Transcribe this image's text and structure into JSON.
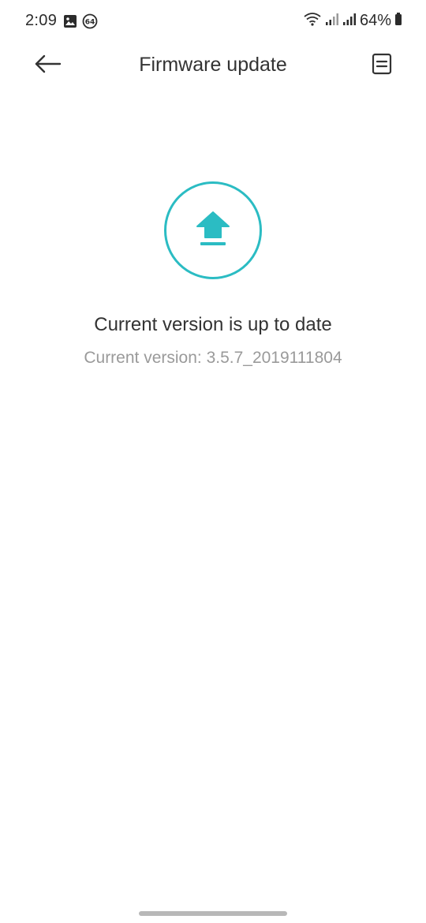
{
  "status_bar": {
    "time": "2:09",
    "left_icons": [
      "gallery-icon",
      "notification-64-icon"
    ],
    "notification_badge": "64",
    "right_icons": [
      "wifi-icon",
      "signal-icon",
      "signal-icon"
    ],
    "battery_percent": "64%"
  },
  "app_bar": {
    "title": "Firmware update",
    "back_icon": "arrow-left-icon",
    "log_icon": "document-icon"
  },
  "main": {
    "icon": "upload-icon",
    "heading": "Current version is up to date",
    "version": "Current version: 3.5.7_2019111804"
  },
  "colors": {
    "accent": "#2bbcc3",
    "text_primary": "#333333",
    "text_secondary": "#9a9a9a"
  }
}
